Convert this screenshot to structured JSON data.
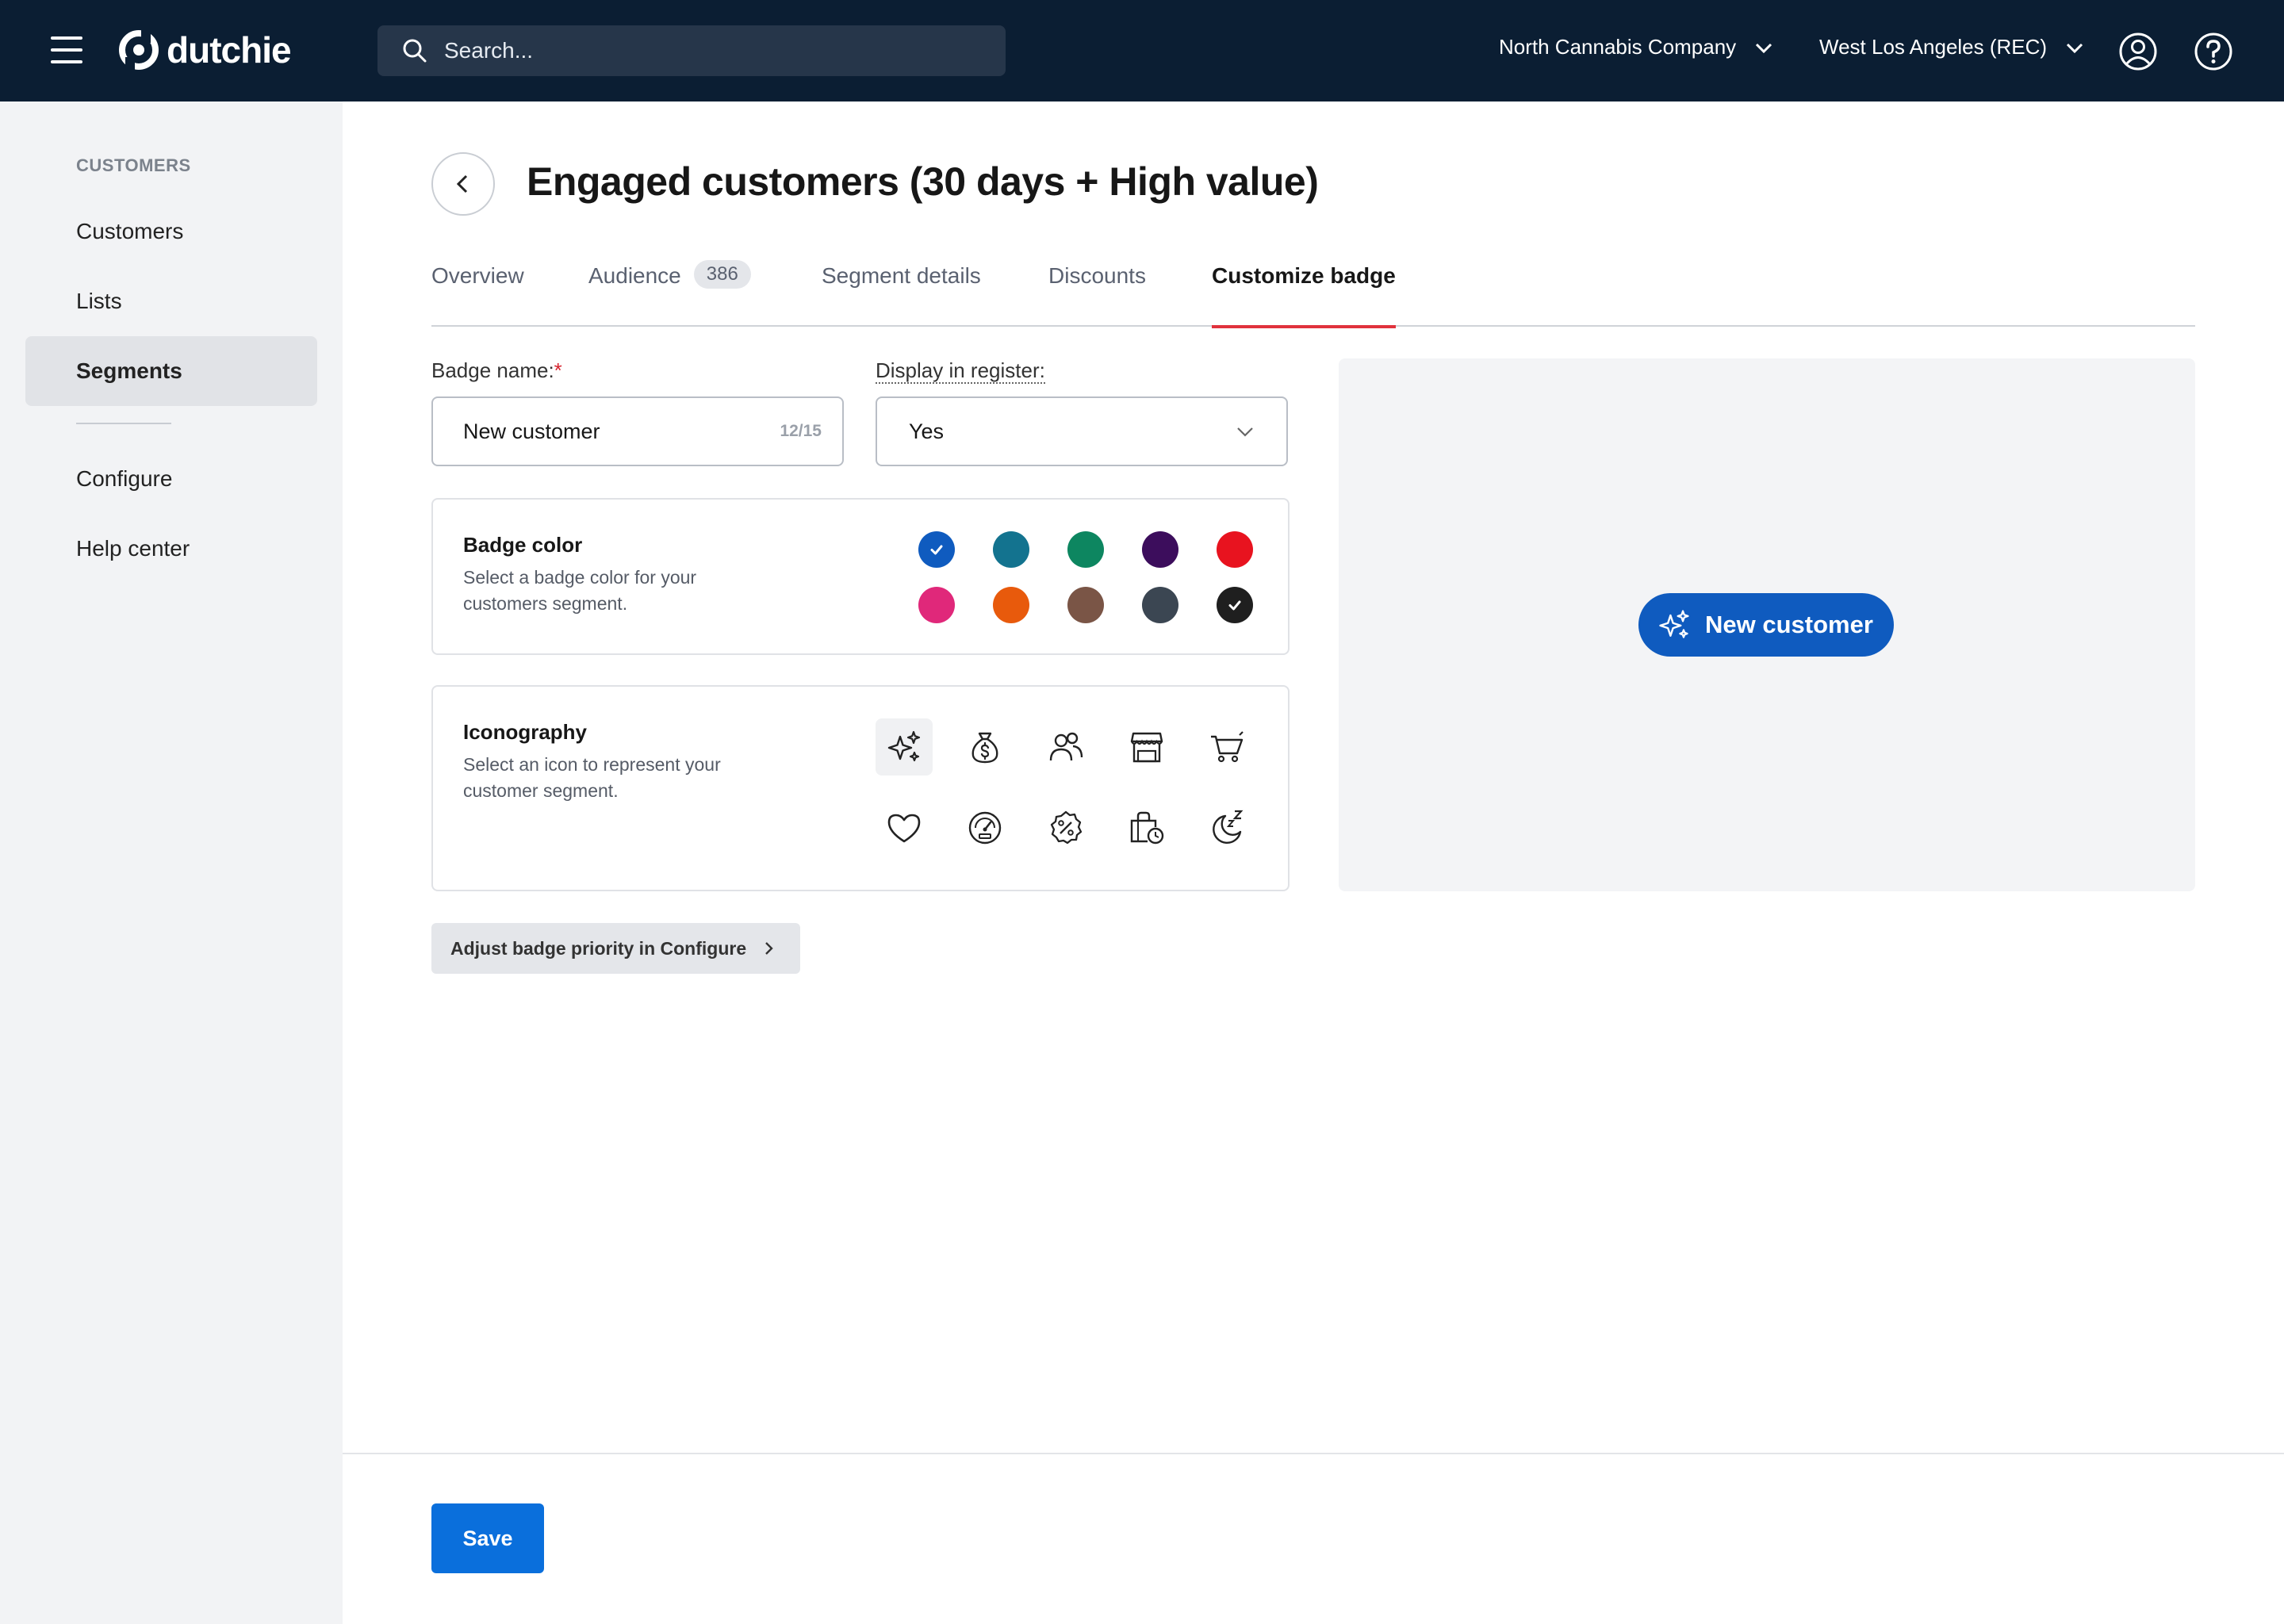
{
  "app": {
    "brand": "dutchie"
  },
  "header": {
    "search_placeholder": "Search...",
    "company": "North Cannabis Company",
    "location": "West Los Angeles (REC)"
  },
  "sidebar": {
    "section": "CUSTOMERS",
    "items": [
      {
        "label": "Customers"
      },
      {
        "label": "Lists"
      },
      {
        "label": "Segments"
      },
      {
        "label": "Configure"
      },
      {
        "label": "Help center"
      }
    ]
  },
  "page": {
    "title": "Engaged customers (30 days + High value)"
  },
  "tabs": [
    {
      "label": "Overview"
    },
    {
      "label": "Audience",
      "count": "386"
    },
    {
      "label": "Segment details"
    },
    {
      "label": "Discounts"
    },
    {
      "label": "Customize badge"
    }
  ],
  "form": {
    "badge_name_label": "Badge name:",
    "required_mark": "*",
    "badge_name_value": "New customer",
    "char_count": "12/15",
    "display_label": "Display in register:",
    "display_value": "Yes"
  },
  "badge_color": {
    "title": "Badge color",
    "description": "Select a badge color for your customers segment.",
    "swatches": [
      "#0f5bbf",
      "#13738f",
      "#0d8660",
      "#3c0d5c",
      "#e8131f",
      "#e0287a",
      "#e85a0c",
      "#7a5546",
      "#3b4652",
      "#1f1f1f"
    ],
    "selected_index": 0
  },
  "iconography": {
    "title": "Iconography",
    "description": "Select an icon to represent your customer segment.",
    "icons": [
      "sparkles-icon",
      "money-bag-icon",
      "users-icon",
      "storefront-icon",
      "cart-icon",
      "heart-icon",
      "speedometer-icon",
      "discount-badge-icon",
      "shopping-bag-clock-icon",
      "sleep-moon-icon"
    ],
    "selected_index": 0
  },
  "priority_button": {
    "label": "Adjust badge priority in Configure"
  },
  "preview": {
    "badge_label": "New customer",
    "badge_color": "#0f5bbf"
  },
  "footer": {
    "save_label": "Save"
  }
}
